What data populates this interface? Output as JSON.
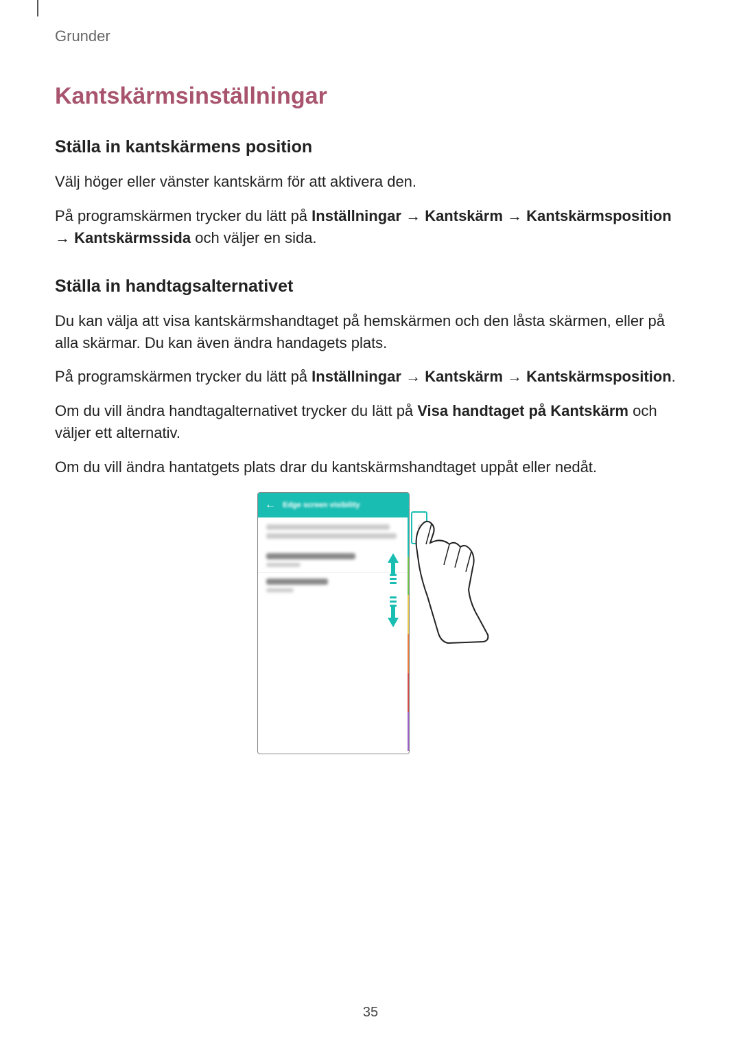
{
  "chapter": "Grunder",
  "title": "Kantskärmsinställningar",
  "section1": {
    "heading": "Ställa in kantskärmens position",
    "p1": "Välj höger eller vänster kantskärm för att aktivera den.",
    "p2a": "På programskärmen trycker du lätt på ",
    "p2b": "Inställningar",
    "p2arrow": " → ",
    "p2c": "Kantskärm",
    "p2d": "Kantskärmsposition",
    "p2e": "Kantskärmssida",
    "p2f": " och väljer en sida."
  },
  "section2": {
    "heading": "Ställa in handtagsalternativet",
    "p1": "Du kan välja att visa kantskärmshandtaget på hemskärmen och den låsta skärmen, eller på alla skärmar. Du kan även ändra handagets plats.",
    "p2a": "På programskärmen trycker du lätt på ",
    "p2b": "Inställningar",
    "p2arrow": " → ",
    "p2c": "Kantskärm",
    "p2d": "Kantskärmsposition",
    "p2e": ".",
    "p3a": "Om du vill ändra handtagalternativet trycker du lätt på ",
    "p3b": "Visa handtaget på Kantskärm",
    "p3c": " och väljer ett alternativ.",
    "p4": "Om du vill ändra hantatgets plats drar du kantskärmshandtaget uppåt eller nedåt."
  },
  "figure": {
    "headerTitle": "Edge screen visibility",
    "backGlyph": "←",
    "handleGlyph": "⇳"
  },
  "pageNumber": "35"
}
